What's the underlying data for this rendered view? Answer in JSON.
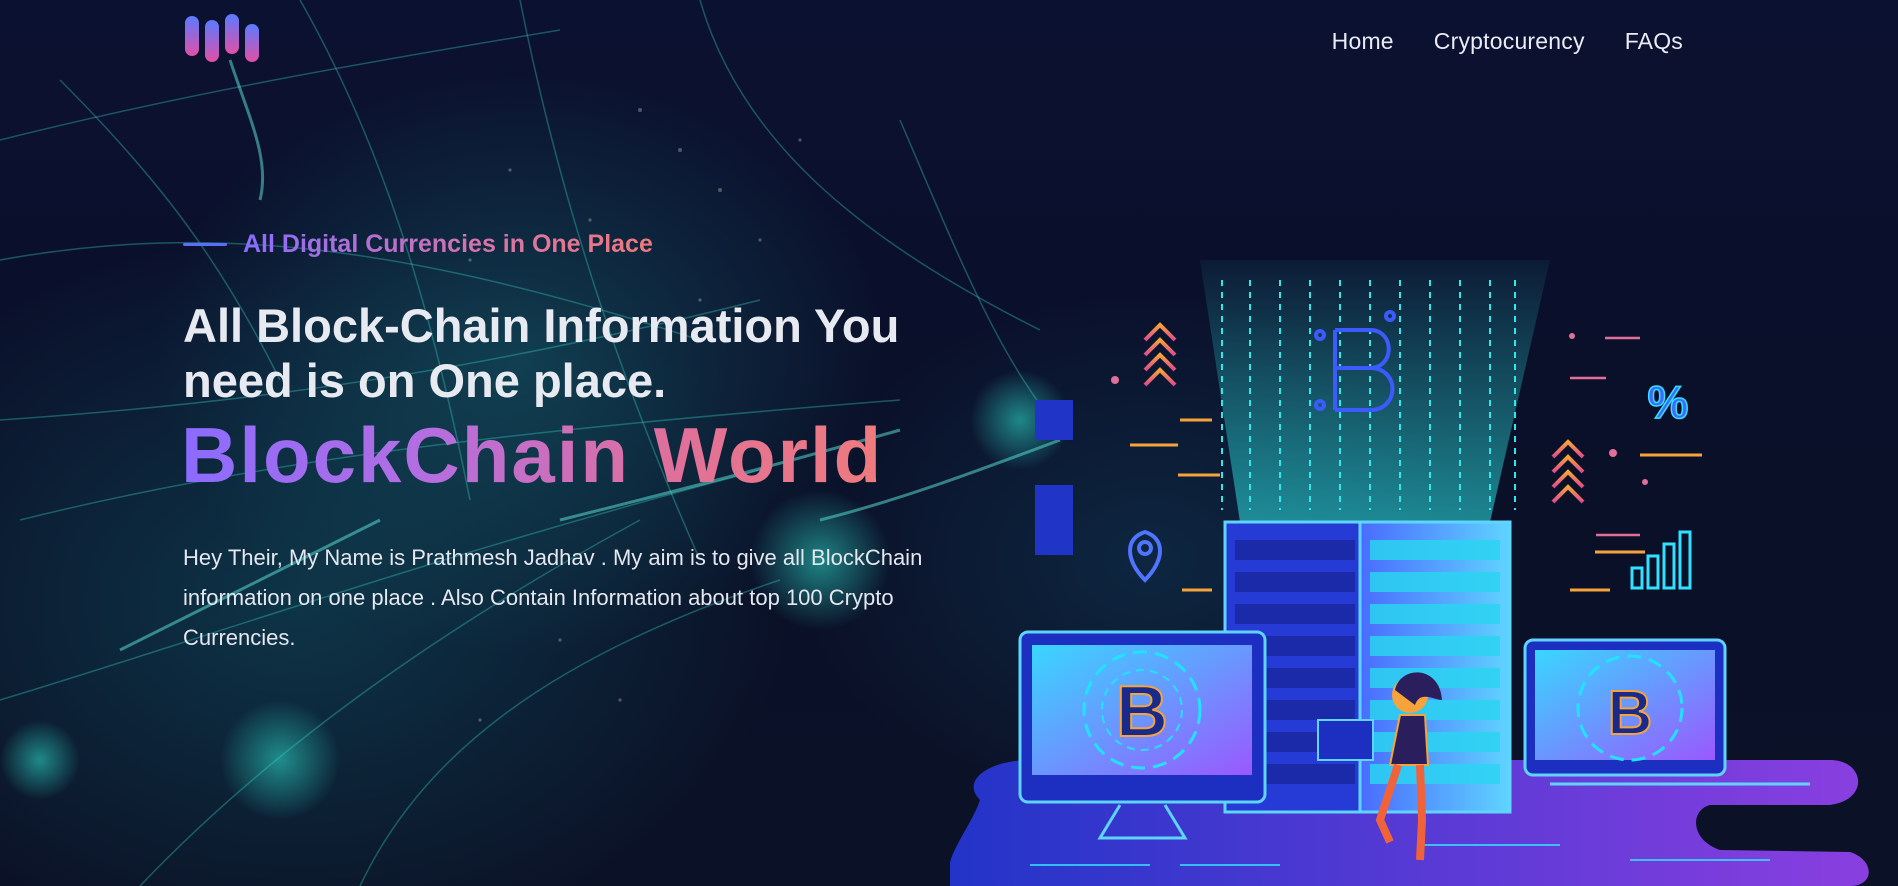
{
  "nav": {
    "items": [
      {
        "label": "Home"
      },
      {
        "label": "Cryptocurency"
      },
      {
        "label": "FAQs"
      }
    ]
  },
  "hero": {
    "eyebrow": "All Digital Currencies in One Place",
    "headline": "All Block-Chain Information You need is on One place.",
    "brand": "BlockChain World",
    "description": "Hey Their, My Name is Prathmesh Jadhav . My aim is to give all BlockChain information on one place . Also Contain Information about top 100 Crypto Currencies."
  },
  "illustration": {
    "coin_glyph": "B",
    "percent_glyph": "%"
  },
  "colors": {
    "accent_purple": "#8b6bff",
    "accent_pink": "#e0709a",
    "accent_coral": "#ef7b7d",
    "cyan": "#33e0ff",
    "background": "#0c1028"
  },
  "icons": [
    "logo-icon",
    "location-pin-icon",
    "bar-chart-icon",
    "percent-icon",
    "bitcoin-icon",
    "chevron-up-icon"
  ]
}
